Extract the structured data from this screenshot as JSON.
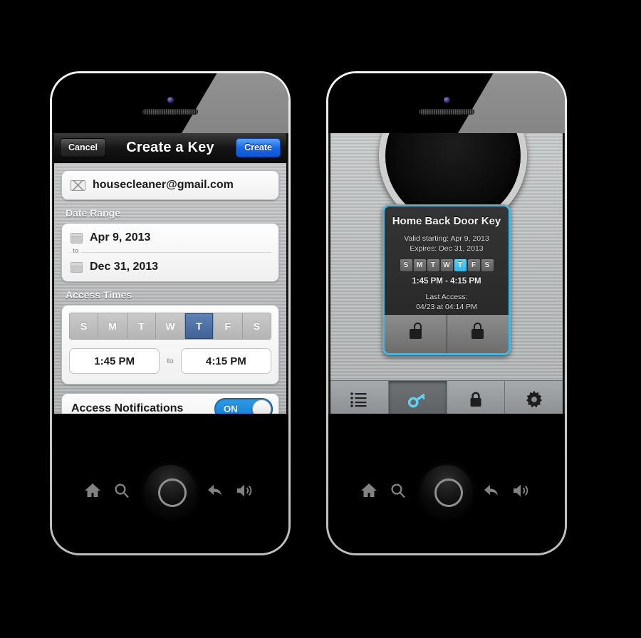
{
  "left_phone": {
    "navbar": {
      "cancel_label": "Cancel",
      "title": "Create a Key",
      "create_label": "Create"
    },
    "email_field": {
      "value": "housecleaner@gmail.com",
      "icon": "envelope-icon"
    },
    "date_range": {
      "section_label": "Date Range",
      "start_date": "Apr 9, 2013",
      "end_date": "Dec 31, 2013",
      "separator": "to",
      "icon": "calendar-icon"
    },
    "access_times": {
      "section_label": "Access Times",
      "days": [
        {
          "letter": "S",
          "selected": false
        },
        {
          "letter": "M",
          "selected": false
        },
        {
          "letter": "T",
          "selected": false
        },
        {
          "letter": "W",
          "selected": false
        },
        {
          "letter": "T",
          "selected": true
        },
        {
          "letter": "F",
          "selected": false
        },
        {
          "letter": "S",
          "selected": false
        }
      ],
      "start_time": "1:45 PM",
      "end_time": "4:15 PM",
      "separator": "to"
    },
    "notifications": {
      "label": "Access Notifications",
      "toggle_state": "ON"
    }
  },
  "right_phone": {
    "key_card": {
      "title": "Home Back Door Key",
      "valid_starting": "Valid starting: Apr 9, 2013",
      "expires": "Expires: Dec 31, 2013",
      "days": [
        {
          "letter": "S",
          "selected": false
        },
        {
          "letter": "M",
          "selected": false
        },
        {
          "letter": "T",
          "selected": false
        },
        {
          "letter": "W",
          "selected": false
        },
        {
          "letter": "T",
          "selected": true
        },
        {
          "letter": "F",
          "selected": false
        },
        {
          "letter": "S",
          "selected": false
        }
      ],
      "time_range": "1:45 PM  -  4:15 PM",
      "last_access_label": "Last Access:",
      "last_access_value": "04/23 at 04:14 PM",
      "unlock_icon": "unlock-icon",
      "lock_icon": "lock-icon"
    },
    "tabbar": {
      "tabs": [
        {
          "name": "list-icon",
          "active": false
        },
        {
          "name": "key-icon",
          "active": true
        },
        {
          "name": "lock-icon",
          "active": false
        },
        {
          "name": "gear-icon",
          "active": false
        }
      ]
    }
  },
  "hardware": {
    "buttons": [
      "home-icon",
      "search-icon",
      "trackball",
      "back-icon",
      "volume-icon"
    ]
  },
  "colors": {
    "accent_blue": "#1667e8",
    "selected_day_blue": "#3f6296",
    "card_cyan": "#49b6df",
    "toggle_blue": "#1279d6",
    "key_icon_cyan": "#5ed2f7"
  }
}
